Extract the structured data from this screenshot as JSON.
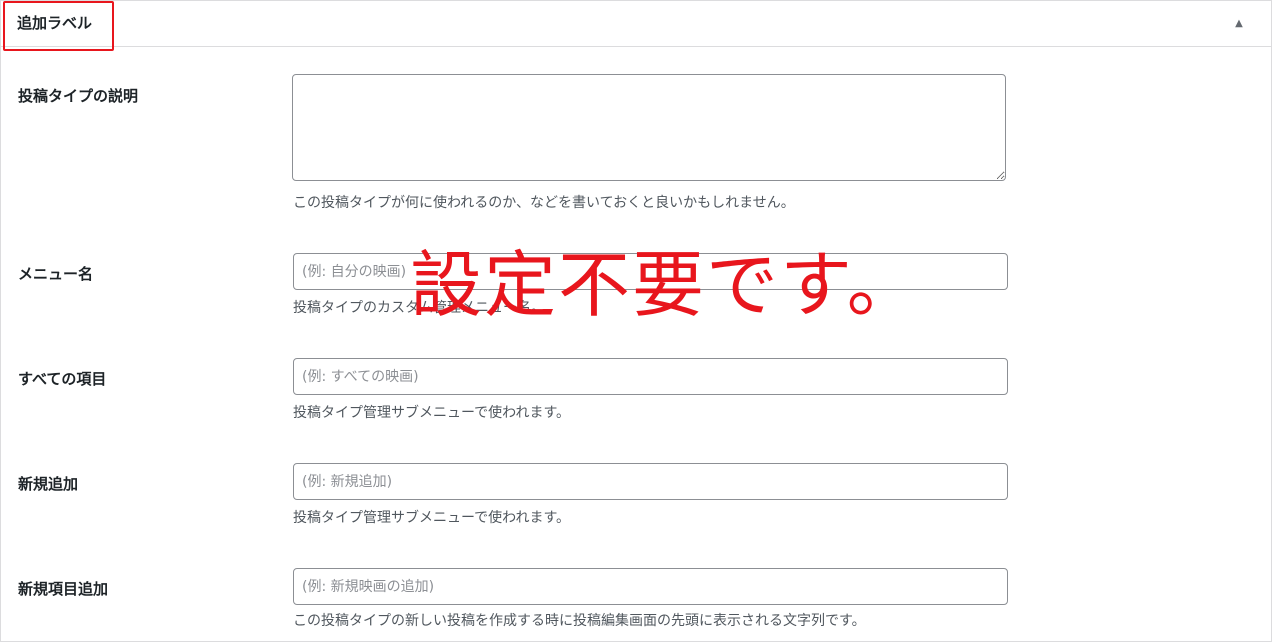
{
  "panel": {
    "title": "追加ラベル",
    "toggle_icon": "triangle-up-icon"
  },
  "fields": [
    {
      "label": "投稿タイプの説明",
      "type": "textarea",
      "value": "",
      "placeholder": "",
      "description": "この投稿タイプが何に使われるのか、などを書いておくと良いかもしれません。"
    },
    {
      "label": "メニュー名",
      "type": "text",
      "value": "",
      "placeholder": "(例: 自分の映画)",
      "description": "投稿タイプのカスタム管理メニュー名。"
    },
    {
      "label": "すべての項目",
      "type": "text",
      "value": "",
      "placeholder": "(例: すべての映画)",
      "description": "投稿タイプ管理サブメニューで使われます。"
    },
    {
      "label": "新規追加",
      "type": "text",
      "value": "",
      "placeholder": "(例: 新規追加)",
      "description": "投稿タイプ管理サブメニューで使われます。"
    },
    {
      "label": "新規項目追加",
      "type": "text",
      "value": "",
      "placeholder": "(例: 新規映画の追加)",
      "description": "この投稿タイプの新しい投稿を作成する時に投稿編集画面の先頭に表示される文字列です。"
    }
  ],
  "annotation": {
    "text": "設定不要です。",
    "color": "#e8161d"
  },
  "colors": {
    "highlight": "#e8161d",
    "border": "#dcdcde",
    "input_border": "#8c8f94",
    "description_text": "#50575e"
  }
}
